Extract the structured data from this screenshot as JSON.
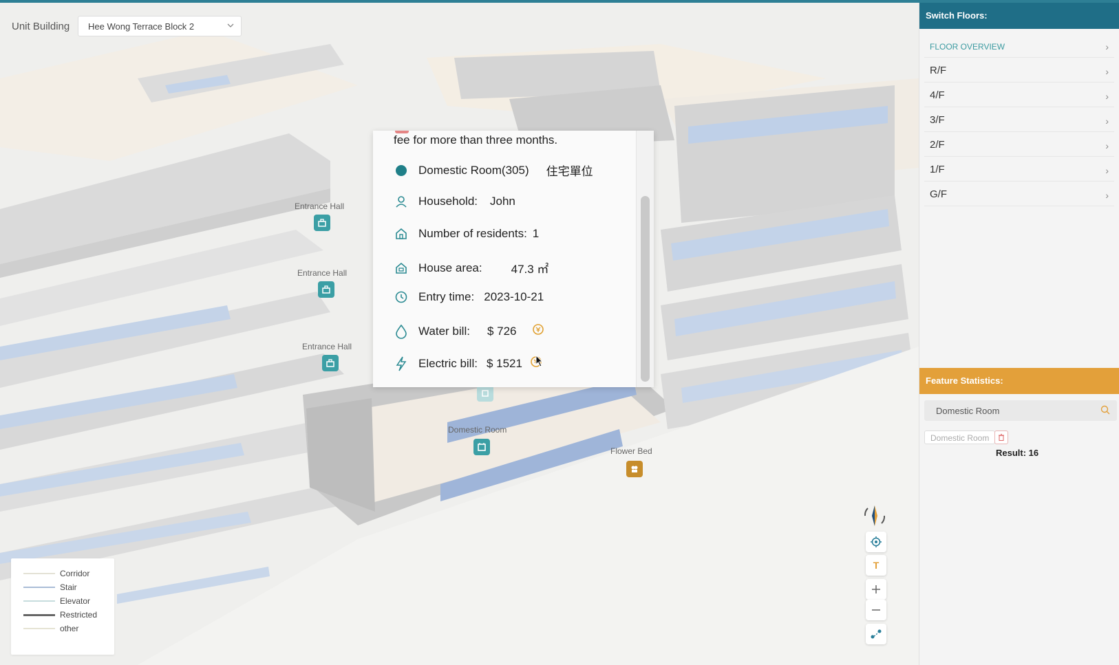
{
  "toolbar": {
    "unit_label": "Unit Building",
    "unit_value": "Hee Wong Terrace Block 2"
  },
  "map_labels": {
    "entrance_hall_1": "Entrance Hall",
    "entrance_hall_2": "Entrance Hall",
    "entrance_hall_3": "Entrance Hall",
    "domestic_room": "Domestic Room",
    "flower_bed": "Flower Bed"
  },
  "popup": {
    "notice": "fee for more than three months.",
    "room_name": "Domestic Room(305)",
    "room_type_zh": "住宅單位",
    "household_label": "Household:",
    "household_value": "John",
    "residents_label": "Number of residents:",
    "residents_value": "1",
    "area_label": "House area:",
    "area_value": "47.3 ㎡",
    "entry_label": "Entry time:",
    "entry_value": "2023-10-21",
    "water_label": "Water bill:",
    "water_value": "$ 726",
    "electric_label": "Electric bill:",
    "electric_value": "$ 1521",
    "accent_color": "#1f7f88",
    "bill_icon_color": "#e0a030"
  },
  "panel": {
    "floors_title": "Switch Floors:",
    "floors": [
      {
        "label": "FLOOR OVERVIEW"
      },
      {
        "label": "R/F"
      },
      {
        "label": "4/F"
      },
      {
        "label": "3/F"
      },
      {
        "label": "2/F"
      },
      {
        "label": "1/F"
      },
      {
        "label": "G/F"
      }
    ],
    "stats_title": "Feature Statistics:",
    "search_value": "Domestic Room",
    "tag_label": "Domestic Room",
    "result_text": "Result: 16"
  },
  "legend": {
    "items": [
      {
        "label": "Corridor",
        "color": "#e4e2d6"
      },
      {
        "label": "Stair",
        "color": "#a9bcd6"
      },
      {
        "label": "Elevator",
        "color": "#c6dcdd"
      },
      {
        "label": "Restricted",
        "color": "#666666"
      },
      {
        "label": "other",
        "color": "#e6e4d4"
      }
    ]
  },
  "controls": {
    "text_toggle": "T"
  },
  "colors": {
    "header_teal": "#1f6e87",
    "header_orange": "#e3a03a",
    "icon_teal": "#3b9fa5"
  }
}
